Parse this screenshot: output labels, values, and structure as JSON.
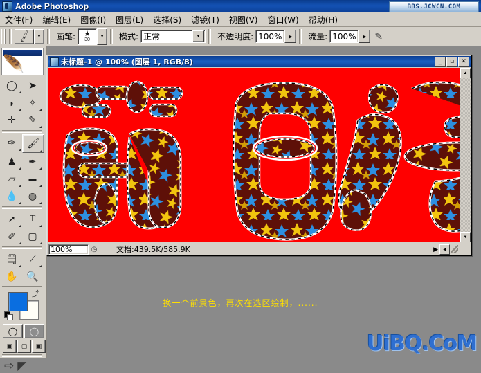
{
  "app": {
    "title": "Adobe Photoshop",
    "logo_icon": "photoshop-logo-icon",
    "watermark_top": "BBS.JCWCN.COM",
    "watermark_bottom": "UiBQ.CoM"
  },
  "menubar": {
    "items": [
      {
        "label": "文件(F)",
        "name": "menu-file"
      },
      {
        "label": "编辑(E)",
        "name": "menu-edit"
      },
      {
        "label": "图像(I)",
        "name": "menu-image"
      },
      {
        "label": "图层(L)",
        "name": "menu-layer"
      },
      {
        "label": "选择(S)",
        "name": "menu-select"
      },
      {
        "label": "滤镜(T)",
        "name": "menu-filter"
      },
      {
        "label": "视图(V)",
        "name": "menu-view"
      },
      {
        "label": "窗口(W)",
        "name": "menu-window"
      },
      {
        "label": "帮助(H)",
        "name": "menu-help"
      }
    ]
  },
  "options_bar": {
    "tool_icon": "brush-tool-icon",
    "tool_dropdown_icon": "chevron-down-icon",
    "brush_label": "画笔:",
    "brush_shape_icon": "star-brush-icon",
    "brush_size": "30",
    "brush_dropdown_icon": "chevron-down-icon",
    "mode_label": "模式:",
    "mode_value": "正常",
    "mode_dropdown_icon": "chevron-down-icon",
    "opacity_label": "不透明度:",
    "opacity_value": "100%",
    "opacity_spin_icon": "triangle-right-icon",
    "flow_label": "流量:",
    "flow_value": "100%",
    "flow_spin_icon": "triangle-right-icon",
    "airbrush_icon": "airbrush-icon"
  },
  "toolbox": {
    "header_icon": "feather-banner-icon",
    "tools": [
      {
        "name": "marquee-tool",
        "glyph": "◯"
      },
      {
        "name": "move-tool",
        "glyph": "➤"
      },
      {
        "name": "lasso-tool",
        "glyph": "◗"
      },
      {
        "name": "magic-wand-tool",
        "glyph": "✦"
      },
      {
        "name": "crop-tool",
        "glyph": "✛"
      },
      {
        "name": "slice-tool",
        "glyph": "✎"
      },
      {
        "name": "healing-brush-tool",
        "glyph": "✑"
      },
      {
        "name": "brush-tool",
        "glyph": "🖌",
        "selected": true
      },
      {
        "name": "clone-stamp-tool",
        "glyph": "♟"
      },
      {
        "name": "history-brush-tool",
        "glyph": "✒"
      },
      {
        "name": "eraser-tool",
        "glyph": "▱"
      },
      {
        "name": "gradient-tool",
        "glyph": "▬"
      },
      {
        "name": "blur-tool",
        "glyph": "💧"
      },
      {
        "name": "dodge-tool",
        "glyph": "◍"
      },
      {
        "name": "path-selection-tool",
        "glyph": "➚"
      },
      {
        "name": "type-tool",
        "glyph": "T"
      },
      {
        "name": "pen-tool",
        "glyph": "✐"
      },
      {
        "name": "shape-tool",
        "glyph": "▢"
      },
      {
        "name": "notes-tool",
        "glyph": "🗒"
      },
      {
        "name": "eyedropper-tool",
        "glyph": "⟋"
      },
      {
        "name": "hand-tool",
        "glyph": "✋"
      },
      {
        "name": "zoom-tool",
        "glyph": "🔍"
      }
    ],
    "colors": {
      "foreground": "#0a6ee0",
      "background": "#fffef7",
      "swap_icon": "swap-colors-icon",
      "default_icon": "default-colors-icon"
    },
    "mask_modes": [
      {
        "name": "standard-mask-mode",
        "glyph": "◯",
        "active": false
      },
      {
        "name": "quick-mask-mode",
        "glyph": "◉",
        "active": true
      }
    ],
    "screen_modes": [
      {
        "name": "standard-screen-mode",
        "glyph": "▣",
        "active": true
      },
      {
        "name": "full-screen-menubar-mode",
        "glyph": "▢",
        "active": false
      },
      {
        "name": "full-screen-mode",
        "glyph": "▣",
        "active": false
      }
    ],
    "jump_to": [
      {
        "name": "jump-to-imageready-icon",
        "glyph": "⇨"
      },
      {
        "name": "imageready-icon",
        "glyph": "◤"
      }
    ]
  },
  "document": {
    "icon": "document-icon",
    "title": "未标题-1 @ 100% (图层 1, RGB/8)",
    "buttons": [
      {
        "name": "minimize-button",
        "glyph": "_"
      },
      {
        "name": "maximize-button",
        "glyph": "▫"
      },
      {
        "name": "close-button",
        "glyph": "✕"
      }
    ],
    "statusbar": {
      "zoom": "100%",
      "doc_icon": "doc-size-icon",
      "text": "文档:439.5K/585.9K",
      "arrow_icon": "triangle-right-icon",
      "handle_icon": "resize-grip-icon"
    },
    "scrollbar": {
      "up_icon": "triangle-up-icon",
      "down_icon": "triangle-down-icon",
      "left_icon": "triangle-left-icon"
    },
    "canvas": {
      "background_color": "#ff0000",
      "artwork_text": "节日好",
      "pattern_colors": [
        "#5e1008",
        "#2d8fe0",
        "#f2c40e"
      ],
      "selection_style": "marching-ants"
    }
  },
  "caption": {
    "text": "换一个前景色，再次在选区绘制，......",
    "color": "#ffe000"
  }
}
